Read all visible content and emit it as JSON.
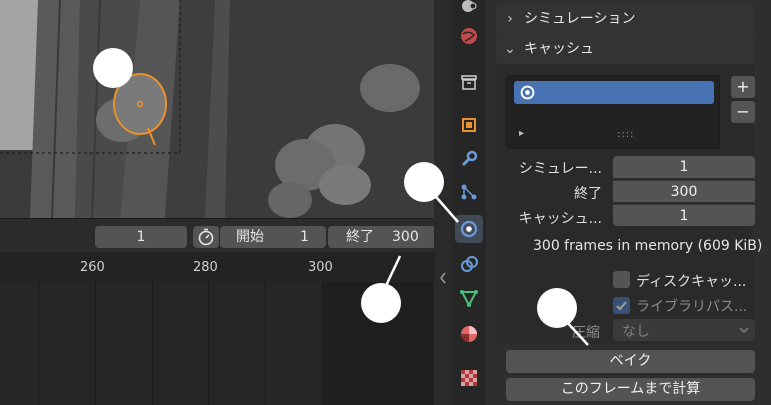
{
  "timeline": {
    "current_frame": "1",
    "start_label": "開始",
    "start_value": "1",
    "end_label": "終了",
    "end_value": "300",
    "ruler_labels": [
      "260",
      "280",
      "300"
    ]
  },
  "properties": {
    "simulation_header": "シミュレーション",
    "cache_header": "キャッシュ",
    "add_button": "+",
    "remove_button": "−",
    "list_handle": "::::",
    "list_expand": "▸",
    "fields": [
      {
        "label": "シミュレー...",
        "value": "1"
      },
      {
        "label": "終了",
        "value": "300"
      },
      {
        "label": "キャッシュ...",
        "value": "1"
      }
    ],
    "memory_info": "300 frames in memory (609 KiB).",
    "disk_cache_label": "ディスクキャッ...",
    "library_path_label": "ライブラリパス...",
    "compression_label": "圧縮",
    "compression_value": "なし",
    "bake_button": "ベイク",
    "calc_to_frame_button": "このフレームまで計算"
  },
  "colors": {
    "accent_blue": "#4772b3",
    "selection_orange": "#e8912d"
  }
}
